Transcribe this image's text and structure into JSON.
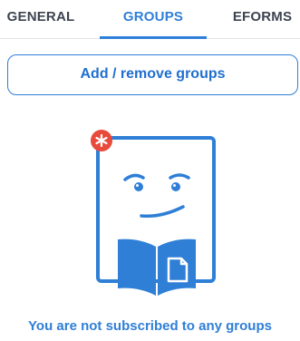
{
  "tabs": {
    "general": "GENERAL",
    "groups": "GROUPS",
    "eforms": "EFORMS",
    "active": "GROUPS"
  },
  "actions": {
    "add_remove_groups": "Add / remove groups"
  },
  "empty_state": {
    "message": "You are not subscribed to any groups",
    "illustration": "smiling-document-with-book-icon",
    "badge_icon": "asterisk-badge-icon"
  },
  "colors": {
    "accent": "#2f7fd7",
    "badge": "#e84a3c",
    "tab_text": "#3d4350",
    "divider": "#e2e6ea"
  }
}
